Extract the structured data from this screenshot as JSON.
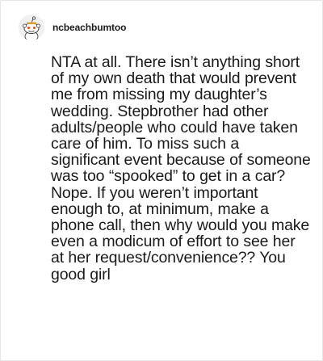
{
  "post": {
    "avatar_icon": "reddit-snoo-avatar-icon",
    "username": "ncbeachbumtoo",
    "comment_text": "NTA at all. There isn’t anything short of my own death that would prevent me from missing my daughter’s wedding. Stepbrother had other adults/people who could have taken care of him. To miss such a significant event because of someone was too “spooked” to get in a car? Nope. If you weren’t important enough to, at minimum, make a phone call, then why would you make even a modicum of effort to see her at her request/convenience?? You good girl"
  }
}
